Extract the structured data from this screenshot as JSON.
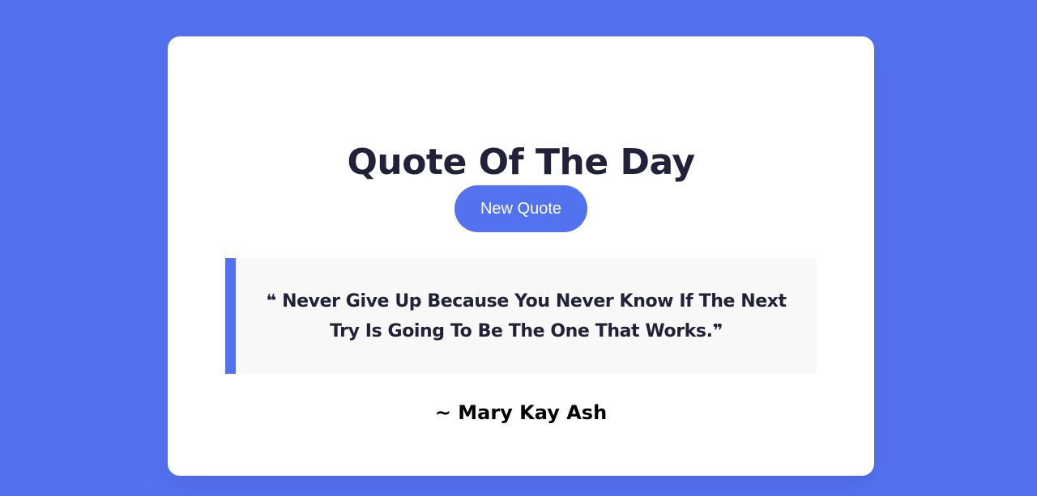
{
  "card": {
    "title": "Quote Of The Day",
    "button_label": "New Quote",
    "quote": "❝ Never Give Up Because You Never Know If The Next Try Is Going To Be The One That Works.❞",
    "author": "~ Mary Kay Ash"
  },
  "colors": {
    "background": "#5372f0",
    "accent": "#5372f0",
    "card": "#ffffff",
    "quote_box": "#f8f8f8",
    "text": "#21213a"
  }
}
